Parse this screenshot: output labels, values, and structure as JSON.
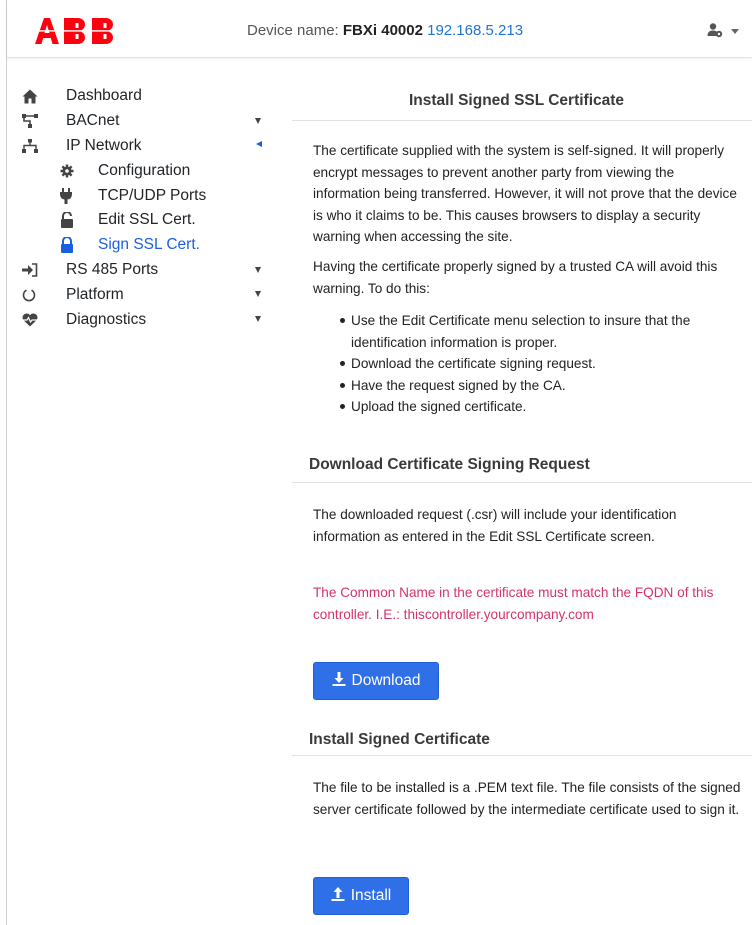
{
  "header": {
    "logo": "ABB",
    "device_label": "Device name:",
    "device_name": "FBXi 40002",
    "device_ip": "192.168.5.213",
    "user_icon": "user-gear-icon"
  },
  "colors": {
    "accent": "#1a5fe3",
    "logo_red": "#ff000f",
    "button": "#2f6fe8",
    "warning": "#d6336c"
  },
  "sidebar": {
    "items": [
      {
        "label": "Dashboard",
        "icon": "home-icon"
      },
      {
        "label": "BACnet",
        "icon": "network-icon"
      },
      {
        "label": "IP Network",
        "icon": "sitemap-icon"
      },
      {
        "label": "Configuration",
        "icon": "cog-icon"
      },
      {
        "label": "TCP/UDP Ports",
        "icon": "plug-icon"
      },
      {
        "label": "Edit SSL Cert.",
        "icon": "unlock-icon"
      },
      {
        "label": "Sign SSL Cert.",
        "icon": "lock-icon"
      },
      {
        "label": "RS 485 Ports",
        "icon": "sign-in-icon"
      },
      {
        "label": "Platform",
        "icon": "power-icon"
      },
      {
        "label": "Diagnostics",
        "icon": "heartbeat-icon"
      }
    ]
  },
  "main": {
    "install_ssl": {
      "title": "Install Signed SSL Certificate",
      "para1": "The certificate supplied with the system is self-signed. It will properly encrypt messages to prevent another party from viewing the information being transferred. However, it will not prove that the device is who it claims to be. This causes browsers to display a security warning when accessing the site.",
      "para2": "Having the certificate properly signed by a trusted CA will avoid this warning. To do this:",
      "steps": [
        "Use the Edit Certificate menu selection to insure that the identification information is proper.",
        "Download the certificate signing request.",
        "Have the request signed by the CA.",
        "Upload the signed certificate."
      ]
    },
    "download_csr": {
      "title": "Download Certificate Signing Request",
      "para": "The downloaded request (.csr) will include your identification information as entered in the Edit SSL Certificate screen.",
      "warning": "The Common Name in the certificate must match the FQDN of this controller. I.E.: thiscontroller.yourcompany.com",
      "button": "Download"
    },
    "install_cert": {
      "title": "Install Signed Certificate",
      "para": "The file to be installed is a .PEM text file. The file consists of the signed server certificate followed by the intermediate certificate used to sign it.",
      "button": "Install"
    }
  }
}
